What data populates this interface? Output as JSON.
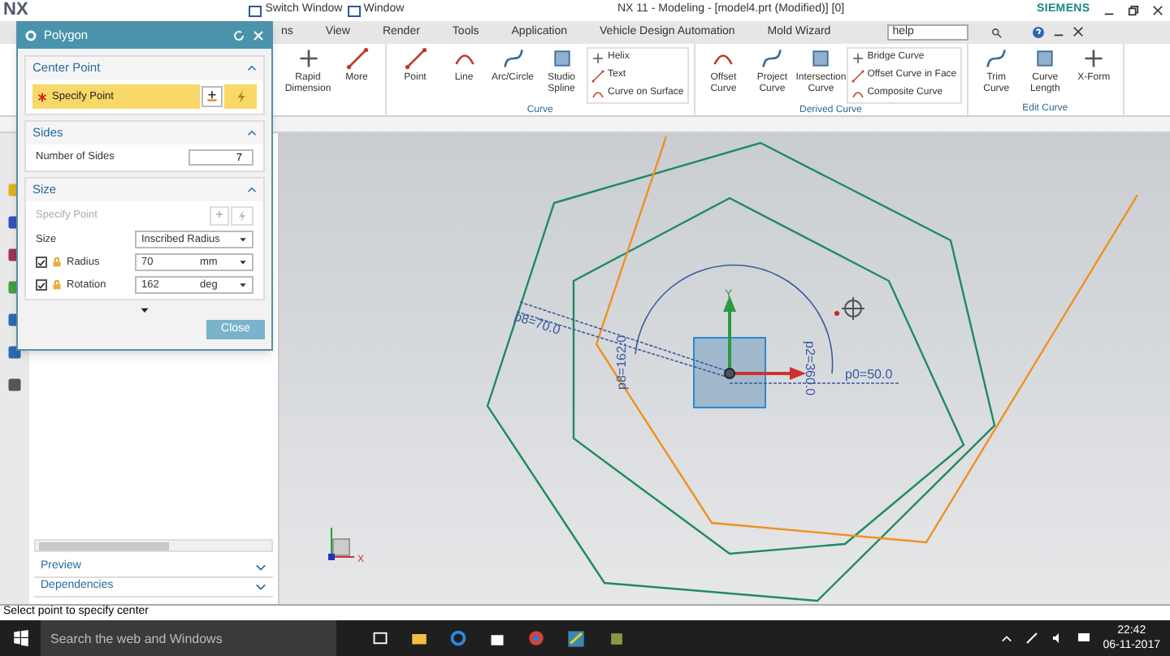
{
  "window": {
    "app_logo": "NX",
    "title": "NX 11 - Modeling - [model4.prt (Modified)]  [0]",
    "brand": "SIEMENS",
    "quick_access": [
      "Switch Window",
      "Window"
    ]
  },
  "menu_tabs": [
    {
      "label": "ns"
    },
    {
      "label": "View"
    },
    {
      "label": "Render"
    },
    {
      "label": "Tools"
    },
    {
      "label": "Application"
    },
    {
      "label": "Vehicle Design Automation"
    },
    {
      "label": "Mold Wizard"
    }
  ],
  "help_field": {
    "value": "help"
  },
  "ribbon_groups": [
    {
      "items": [
        {
          "kind": "large",
          "label": "Rapid Dimension"
        },
        {
          "kind": "large",
          "label": "More"
        }
      ]
    },
    {
      "label": "Curve",
      "items": [
        {
          "kind": "large",
          "label": "Point"
        },
        {
          "kind": "large",
          "label": "Line"
        },
        {
          "kind": "large",
          "label": "Arc/Circle"
        },
        {
          "kind": "large",
          "label": "Studio Spline"
        },
        {
          "kind": "small",
          "label": "Helix"
        },
        {
          "kind": "small",
          "label": "Text"
        },
        {
          "kind": "small",
          "label": "Curve on Surface"
        }
      ]
    },
    {
      "label": "Derived Curve",
      "items": [
        {
          "kind": "large",
          "label": "Offset Curve"
        },
        {
          "kind": "large",
          "label": "Project Curve"
        },
        {
          "kind": "large",
          "label": "Intersection Curve"
        },
        {
          "kind": "small",
          "label": "Bridge Curve"
        },
        {
          "kind": "small",
          "label": "Offset Curve in Face"
        },
        {
          "kind": "small",
          "label": "Composite Curve"
        }
      ]
    },
    {
      "label": "Edit Curve",
      "items": [
        {
          "kind": "large",
          "label": "Trim Curve"
        },
        {
          "kind": "large",
          "label": "Curve Length"
        },
        {
          "kind": "large",
          "label": "X-Form"
        }
      ]
    }
  ],
  "dialog": {
    "title": "Polygon",
    "sections": [
      {
        "kind": "point",
        "title": "Center Point",
        "expanded": true,
        "label": "Specify Point",
        "active": true
      },
      {
        "kind": "sides",
        "title": "Sides",
        "expanded": true,
        "label": "Number of Sides",
        "value": "7"
      },
      {
        "kind": "size",
        "title": "Size",
        "expanded": true,
        "point_label": "Specify Point",
        "size_label": "Size",
        "size_value": "Inscribed Radius",
        "rows": [
          {
            "label": "Radius",
            "checked": true,
            "value": "70",
            "unit": "mm"
          },
          {
            "label": "Rotation",
            "checked": true,
            "value": "162",
            "unit": "deg"
          }
        ]
      }
    ],
    "close_button": "Close"
  },
  "navigator": {
    "sections": [
      {
        "label": "Preview",
        "expanded": false
      },
      {
        "label": "Dependencies",
        "expanded": false
      }
    ]
  },
  "viewport": {
    "dimension_labels": [
      "p8=70.0",
      "p8=162.0",
      "p2=360.0",
      "p0=50.0"
    ],
    "axis_labels": [
      "Y",
      "X"
    ]
  },
  "status_bar": {
    "message": "Select point to specify center"
  },
  "taskbar": {
    "search_placeholder": "Search the web and Windows",
    "time": "22:42",
    "date": "06-11-2017"
  }
}
